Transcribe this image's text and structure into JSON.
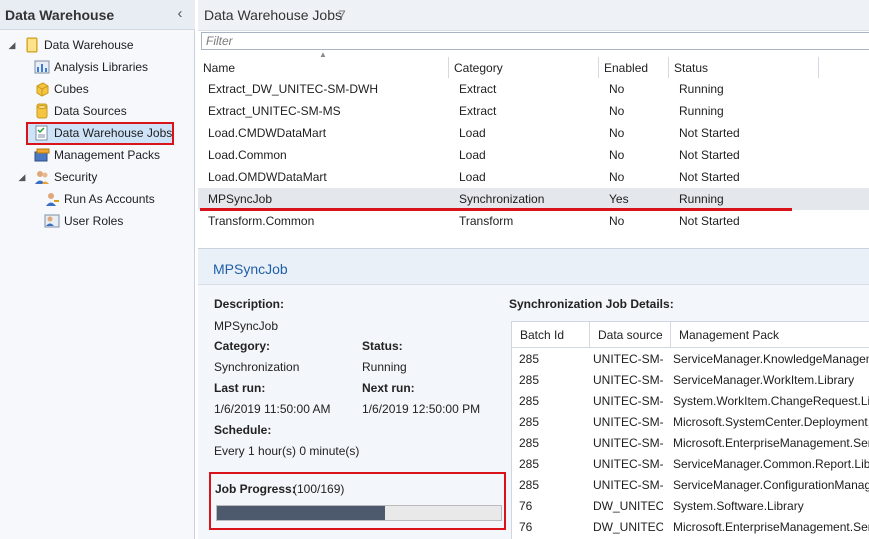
{
  "nav": {
    "title": "Data Warehouse",
    "collapse_glyph": "‹",
    "tree": [
      {
        "label": "Data Warehouse",
        "icon": "folder-icon",
        "expander": "◢"
      },
      {
        "label": "Analysis Libraries",
        "icon": "chart-icon"
      },
      {
        "label": "Cubes",
        "icon": "cube-icon"
      },
      {
        "label": "Data Sources",
        "icon": "database-icon"
      },
      {
        "label": "Data Warehouse Jobs",
        "icon": "jobs-icon"
      },
      {
        "label": "Management Packs",
        "icon": "package-icon"
      },
      {
        "label": "Security",
        "icon": "users-icon",
        "expander": "◢"
      },
      {
        "label": "Run As Accounts",
        "icon": "key-user-icon"
      },
      {
        "label": "User Roles",
        "icon": "user-roles-icon"
      }
    ],
    "selected_index": 4
  },
  "jobs": {
    "title": "Data Warehouse Jobs",
    "count": "7",
    "filter_placeholder": "Filter",
    "columns": [
      "Name",
      "Category",
      "Enabled",
      "Status"
    ],
    "rows": [
      [
        "Extract_DW_UNITEC-SM-DWH",
        "Extract",
        "No",
        "Running"
      ],
      [
        "Extract_UNITEC-SM-MS",
        "Extract",
        "No",
        "Running"
      ],
      [
        "Load.CMDWDataMart",
        "Load",
        "No",
        "Not Started"
      ],
      [
        "Load.Common",
        "Load",
        "No",
        "Not Started"
      ],
      [
        "Load.OMDWDataMart",
        "Load",
        "No",
        "Not Started"
      ],
      [
        "MPSyncJob",
        "Synchronization",
        "Yes",
        "Running"
      ],
      [
        "Transform.Common",
        "Transform",
        "No",
        "Not Started"
      ]
    ],
    "selected_row": 5
  },
  "details": {
    "title": "MPSyncJob",
    "description_label": "Description:",
    "description": "MPSyncJob",
    "category_label": "Category:",
    "category": "Synchronization",
    "status_label": "Status:",
    "status": "Running",
    "last_run_label": "Last run:",
    "last_run": "1/6/2019 11:50:00 AM",
    "next_run_label": "Next run:",
    "next_run": "1/6/2019 12:50:00 PM",
    "schedule_label": "Schedule:",
    "schedule": "Every 1 hour(s) 0 minute(s)",
    "progress_label": "Job Progress:",
    "progress_text": "(100/169)",
    "progress_fraction": 0.59
  },
  "sync": {
    "title": "Synchronization Job Details:",
    "columns": [
      "Batch Id",
      "Data source",
      "Management Pack"
    ],
    "rows": [
      [
        "285",
        "UNITEC-SM-MS",
        "ServiceManager.KnowledgeManagement"
      ],
      [
        "285",
        "UNITEC-SM-MS",
        "ServiceManager.WorkItem.Library"
      ],
      [
        "285",
        "UNITEC-SM-MS",
        "System.WorkItem.ChangeRequest.Library"
      ],
      [
        "285",
        "UNITEC-SM-MS",
        "Microsoft.SystemCenter.Deployment.Library"
      ],
      [
        "285",
        "UNITEC-SM-MS",
        "Microsoft.EnterpriseManagement.ServiceManager"
      ],
      [
        "285",
        "UNITEC-SM-MS",
        "ServiceManager.Common.Report.Library"
      ],
      [
        "285",
        "UNITEC-SM-MS",
        "ServiceManager.ConfigurationManagement"
      ],
      [
        "76",
        "DW_UNITEC-SM-DWH",
        "System.Software.Library"
      ],
      [
        "76",
        "DW_UNITEC-SM-DWH",
        "Microsoft.EnterpriseManagement.ServiceManager"
      ]
    ]
  }
}
